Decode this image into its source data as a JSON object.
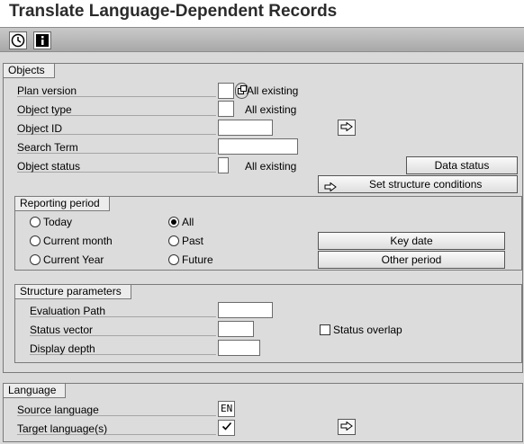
{
  "window": {
    "title": "Translate Language-Dependent Records"
  },
  "toolbar": {
    "items": [
      {
        "icon": "execute-clock-icon"
      },
      {
        "icon": "information-icon"
      }
    ]
  },
  "objects": {
    "group_label": "Objects",
    "plan_version": {
      "label": "Plan version",
      "value": "",
      "note": "All existing"
    },
    "object_type": {
      "label": "Object type",
      "value": "",
      "note": "All existing"
    },
    "object_id": {
      "label": "Object ID",
      "value": ""
    },
    "search_term": {
      "label": "Search Term",
      "value": ""
    },
    "object_status": {
      "label": "Object status",
      "value": "",
      "note": "All existing"
    },
    "data_status_button": "Data status",
    "set_structure_button": "Set structure conditions"
  },
  "reporting_period": {
    "group_label": "Reporting period",
    "options": [
      "Today",
      "All",
      "Current month",
      "Past",
      "Current Year",
      "Future"
    ],
    "selected": "All",
    "key_date_button": "Key date",
    "other_period_button": "Other period"
  },
  "structure_parameters": {
    "group_label": "Structure parameters",
    "evaluation_path": {
      "label": "Evaluation Path",
      "value": ""
    },
    "status_vector": {
      "label": "Status vector",
      "value": ""
    },
    "display_depth": {
      "label": "Display depth",
      "value": ""
    },
    "status_overlap": {
      "label": "Status overlap",
      "checked": false
    }
  },
  "language": {
    "group_label": "Language",
    "source_language": {
      "label": "Source language",
      "value": "EN"
    },
    "target_languages": {
      "label": "Target language(s)",
      "checked": true
    }
  }
}
